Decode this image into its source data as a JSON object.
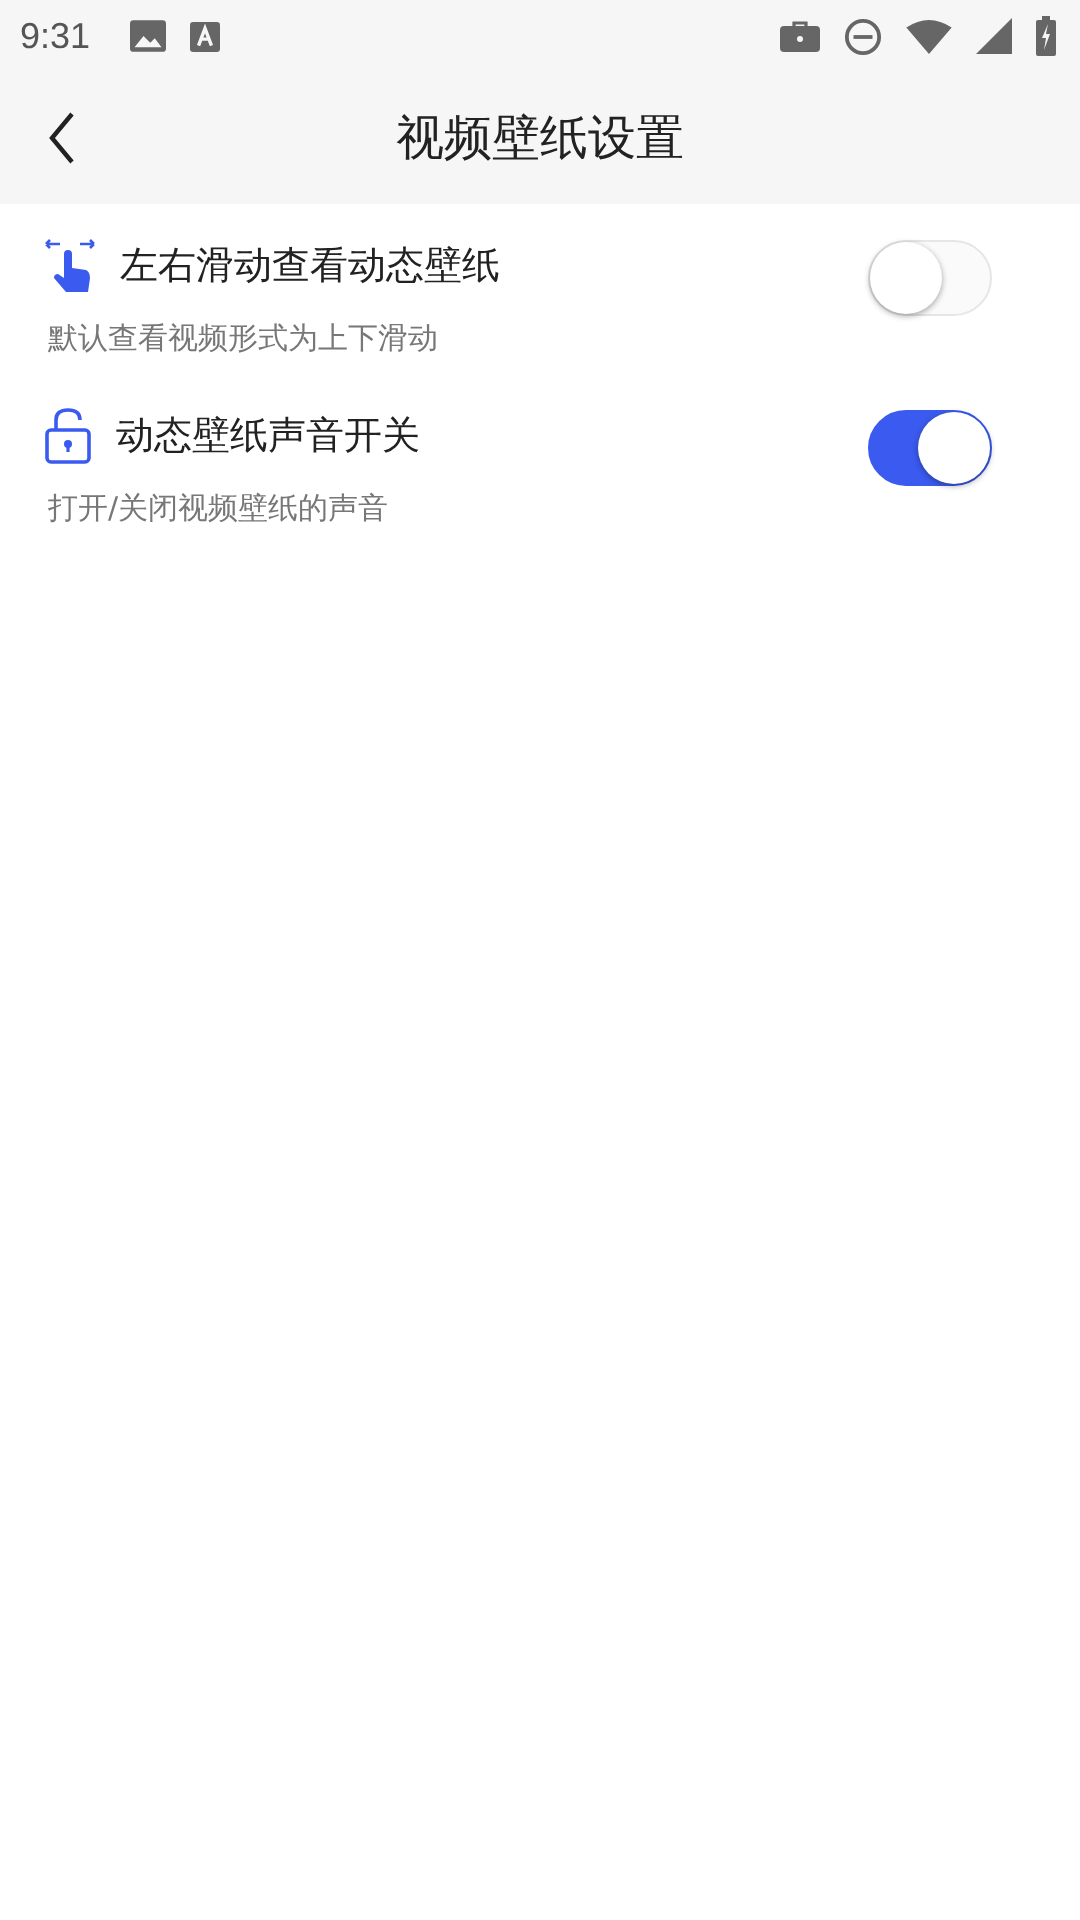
{
  "status_bar": {
    "time": "9:31"
  },
  "header": {
    "title": "视频壁纸设置"
  },
  "settings": [
    {
      "title": "左右滑动查看动态壁纸",
      "description": "默认查看视频形式为上下滑动",
      "on": false
    },
    {
      "title": "动态壁纸声音开关",
      "description": "打开/关闭视频壁纸的声音",
      "on": true
    }
  ]
}
